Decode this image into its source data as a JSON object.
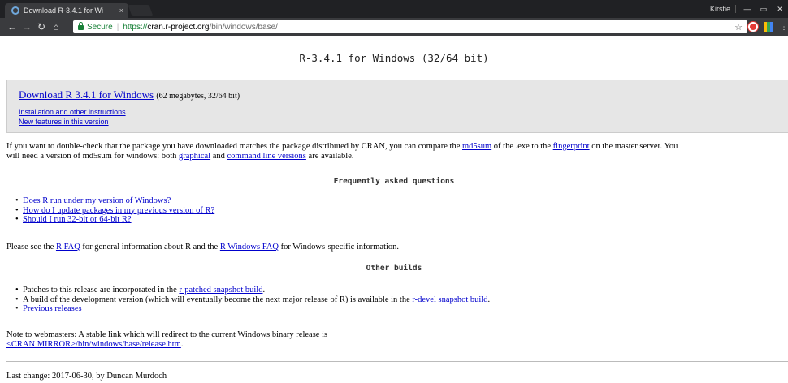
{
  "browser": {
    "tab_title": "Download R-3.4.1 for Wi",
    "tab_close": "×",
    "profile": "Kirstie",
    "minimize": "—",
    "restore": "▭",
    "close": "✕",
    "secure_label": "Secure",
    "separator": "|",
    "url_scheme": "https://",
    "url_host": "cran.r-project.org",
    "url_path": "/bin/windows/base/",
    "icons": [
      "back-icon",
      "forward-icon",
      "reload-icon",
      "home-icon",
      "lock-icon",
      "star-icon",
      "opera-icon",
      "extension-icon",
      "menu-icon"
    ]
  },
  "page": {
    "title": "R-3.4.1 for Windows (32/64 bit)",
    "download": {
      "link": "Download R 3.4.1 for Windows",
      "size": "(62 megabytes, 32/64 bit)",
      "install_link": "Installation and other instructions",
      "features_link": "New features in this version"
    },
    "checksum": {
      "t1": "If you want to double-check that the package you have downloaded matches the package distributed by CRAN, you can compare the ",
      "md5_link": "md5sum",
      "t2": " of the .exe to the ",
      "fingerprint_link": "fingerprint",
      "t3": " on the master server. You",
      "t4": "will need a version of md5sum for windows: both ",
      "graphical_link": "graphical",
      "t5": " and ",
      "cmdline_link": "command line versions",
      "t6": " are available."
    },
    "faq_heading": "Frequently asked questions",
    "faq_items": [
      "Does R run under my version of Windows?",
      "How do I update packages in my previous version of R?",
      "Should I run 32-bit or 64-bit R?"
    ],
    "faq_note": {
      "t1": "Please see the ",
      "rfaq_link": "R FAQ",
      "t2": " for general information about R and the ",
      "winfaq_link": "R Windows FAQ",
      "t3": " for Windows-specific information."
    },
    "other_heading": "Other builds",
    "other": {
      "i1_text": "Patches to this release are incorporated in the ",
      "i1_link": "r-patched snapshot build",
      "i1_end": ".",
      "i2_text": "A build of the development version (which will eventually become the next major release of R) is available in the ",
      "i2_link": "r-devel snapshot build",
      "i2_end": ".",
      "i3_link": "Previous releases"
    },
    "webmasters": {
      "t1": "Note to webmasters: A stable link which will redirect to the current Windows binary release is",
      "link": "<CRAN MIRROR>/bin/windows/base/release.htm",
      "end": "."
    },
    "last_change": "Last change: 2017-06-30, by Duncan Murdoch"
  }
}
